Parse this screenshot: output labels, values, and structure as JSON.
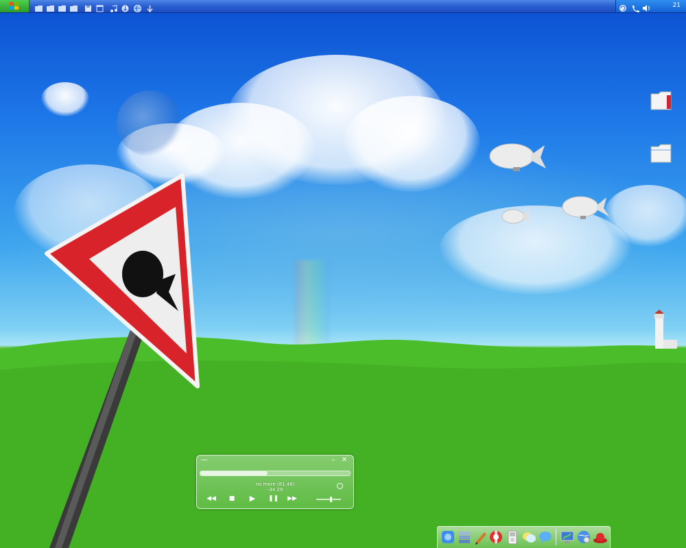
{
  "taskbar": {
    "start_icon": "windows-logo-icon",
    "quick_launch": [
      {
        "name": "folder-icon"
      },
      {
        "name": "folder-icon"
      },
      {
        "name": "folder-icon"
      },
      {
        "name": "folder-icon"
      },
      {
        "name": "disk-icon"
      },
      {
        "name": "window-icon"
      },
      {
        "name": "music-icon"
      },
      {
        "name": "download-icon"
      },
      {
        "name": "globe-icon"
      },
      {
        "name": "arrow-down-icon"
      }
    ],
    "tray": {
      "icons": [
        "refresh-icon",
        "phone-icon",
        "speaker-icon"
      ],
      "clock": "21"
    }
  },
  "desktop_icons": [
    {
      "name": "folder-bookmark-icon"
    },
    {
      "name": "folder-icon"
    }
  ],
  "player": {
    "track_title": "no more (81.48)",
    "time": "-34 29",
    "progress": 0.45,
    "volume": 0.6
  },
  "dock": {
    "items": [
      "finder-icon",
      "server-icon",
      "pencil-icon",
      "lifebuoy-icon",
      "ipod-icon",
      "chat-icon",
      "speech-bubble-icon",
      "monitor-icon",
      "globe-icon",
      "hat-icon"
    ]
  },
  "colors": {
    "taskbar_blue": "#2a5fd0",
    "start_green": "#3cb43c",
    "sign_red": "#d8232a",
    "grass_green": "#48b52a",
    "sky_blue": "#1e78e8"
  }
}
